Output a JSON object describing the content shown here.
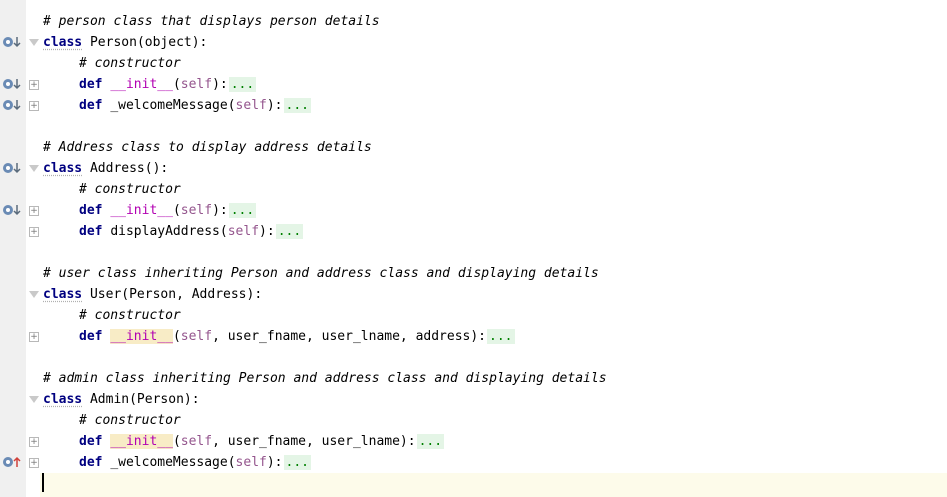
{
  "editor": {
    "language": "python",
    "lines": [
      {
        "type": "comment",
        "text": "# person class that displays person details"
      },
      {
        "type": "class",
        "kw": "class",
        "name": "Person",
        "args": "(object):"
      },
      {
        "type": "comment",
        "text": "# constructor"
      },
      {
        "type": "def",
        "kw": "def",
        "name": "__init__",
        "params": "(self):",
        "dots": "...",
        "marker": "override-down"
      },
      {
        "type": "def",
        "kw": "def",
        "name": "_welcomeMessage",
        "params": "(self):",
        "dots": "...",
        "marker": "override-down"
      },
      {
        "type": "blank"
      },
      {
        "type": "comment",
        "text": "# Address class to display address details"
      },
      {
        "type": "class",
        "kw": "class",
        "name": "Address",
        "args": "():"
      },
      {
        "type": "comment",
        "text": "# constructor"
      },
      {
        "type": "def",
        "kw": "def",
        "name": "__init__",
        "params": "(self):",
        "dots": "...",
        "marker": "override-down"
      },
      {
        "type": "def",
        "kw": "def",
        "name": "displayAddress",
        "params": "(self):",
        "dots": "..."
      },
      {
        "type": "blank"
      },
      {
        "type": "comment",
        "text": "# user class inheriting Person and address class and displaying details"
      },
      {
        "type": "class",
        "kw": "class",
        "name": "User",
        "args": "(Person, Address):"
      },
      {
        "type": "comment",
        "text": "# constructor"
      },
      {
        "type": "def",
        "kw": "def",
        "name": "__init__",
        "params": "(self, user_fname, user_lname, address):",
        "dots": "..."
      },
      {
        "type": "blank"
      },
      {
        "type": "comment",
        "text": "# admin class inheriting Person and address class and displaying details"
      },
      {
        "type": "class",
        "kw": "class",
        "name": "Admin",
        "args": "(Person):"
      },
      {
        "type": "comment",
        "text": "# constructor"
      },
      {
        "type": "def",
        "kw": "def",
        "name": "__init__",
        "params": "(self, user_fname, user_lname):",
        "dots": "..."
      },
      {
        "type": "def",
        "kw": "def",
        "name": "_welcomeMessage",
        "params": "(self):",
        "dots": "...",
        "marker": "override-up"
      },
      {
        "type": "caret"
      }
    ]
  },
  "text": {
    "c1": "# person class that displays person details",
    "k_class": "class",
    "k_def": "def",
    "n_person": "Person",
    "a_person": "(object):",
    "c_ctor": "# constructor",
    "n_init": "__init__",
    "p_self": "self",
    "p_open": "(",
    "p_close": "):",
    "dots": "...",
    "n_welcome": "_welcomeMessage",
    "c2": "# Address class to display address details",
    "n_address": "Address",
    "a_address": "():",
    "n_display": "displayAddress",
    "c3": "# user class inheriting Person and address class and displaying details",
    "n_user": "User",
    "a_user": "(Person, Address):",
    "p_user_rest": ", user_fname, user_lname, address",
    "c4": "# admin class inheriting Person and address class and displaying details",
    "n_admin": "Admin",
    "a_admin": "(Person):",
    "p_admin_rest": ", user_fname, user_lname"
  },
  "colors": {
    "keyword": "#000080",
    "comment": "#808080",
    "self": "#94558d",
    "magic": "#b200b2",
    "fold_dots": "#008000",
    "caret_line": "#fdfbea"
  },
  "icons": {
    "override_down": "override-down-icon",
    "override_up": "override-up-icon"
  }
}
